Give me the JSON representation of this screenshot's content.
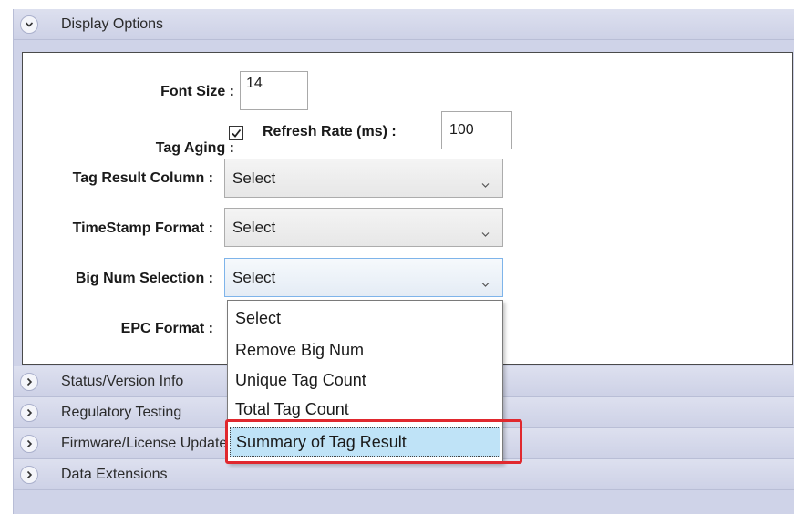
{
  "display_options": {
    "title": "Display Options",
    "font_size": {
      "label": "Font Size :",
      "value": "14"
    },
    "tag_aging": {
      "label": "Tag Aging :",
      "checked": true
    },
    "refresh_rate": {
      "label": "Refresh Rate (ms) :",
      "value": "100"
    },
    "tag_result_column": {
      "label": "Tag Result Column :",
      "selected": "Select"
    },
    "timestamp_format": {
      "label": "TimeStamp Format :",
      "selected": "Select"
    },
    "big_num_selection": {
      "label": "Big Num Selection :",
      "selected": "Select",
      "options": [
        "Select",
        "Remove Big Num",
        "Unique Tag Count",
        "Total Tag Count",
        "Summary of Tag Result"
      ],
      "highlighted_option": "Summary of Tag Result"
    },
    "epc_format": {
      "label": "EPC Format :"
    }
  },
  "sections": {
    "status_version": "Status/Version Info",
    "regulatory_testing": "Regulatory Testing",
    "firmware_license": "Firmware/License Update",
    "data_extensions": "Data Extensions"
  },
  "colors": {
    "accordion_bg": "#cfd3e8",
    "selection_bg": "#bfe3f7",
    "highlight_border": "#e0282e"
  }
}
